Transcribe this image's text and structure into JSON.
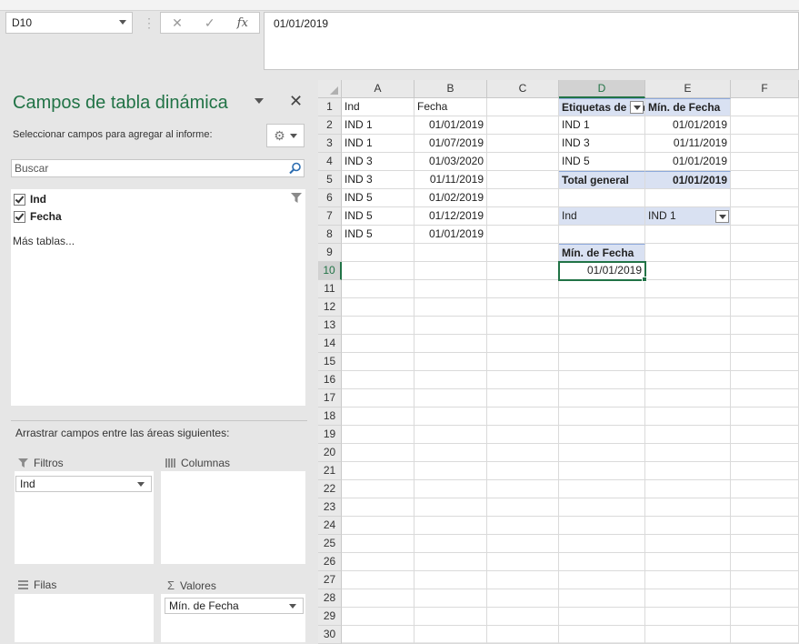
{
  "formula_bar": {
    "name_box": "D10",
    "cancel_icon": "✕",
    "enter_icon": "✓",
    "fx_label": "fx",
    "formula": "01/01/2019"
  },
  "pivot_pane": {
    "title": "Campos de tabla dinámica",
    "subtitle": "Seleccionar campos para agregar al informe:",
    "search_placeholder": "Buscar",
    "fields": [
      {
        "label": "Ind",
        "checked": true
      },
      {
        "label": "Fecha",
        "checked": true
      }
    ],
    "more_tables": "Más tablas...",
    "drag_label": "Arrastrar campos entre las áreas siguientes:",
    "areas": {
      "filters": {
        "label": "Filtros",
        "items": [
          "Ind"
        ]
      },
      "columns": {
        "label": "Columnas",
        "items": []
      },
      "rows": {
        "label": "Filas",
        "items": []
      },
      "values": {
        "label": "Valores",
        "items": [
          "Mín. de Fecha"
        ]
      }
    }
  },
  "sheet": {
    "columns": [
      "A",
      "B",
      "C",
      "D",
      "E",
      "F"
    ],
    "selected_column": "D",
    "rows": [
      "1",
      "2",
      "3",
      "4",
      "5",
      "6",
      "7",
      "8",
      "9",
      "10",
      "11",
      "12",
      "13",
      "14",
      "15",
      "16",
      "17",
      "18",
      "19",
      "20",
      "21",
      "22",
      "23",
      "24",
      "25",
      "26",
      "27",
      "28",
      "29",
      "30"
    ],
    "selected_row": "10",
    "source_table": {
      "headers": [
        "Ind",
        "Fecha"
      ],
      "rows": [
        [
          "IND 1",
          "01/01/2019"
        ],
        [
          "IND 1",
          "01/07/2019"
        ],
        [
          "IND 3",
          "01/03/2020"
        ],
        [
          "IND 3",
          "01/11/2019"
        ],
        [
          "IND 5",
          "01/02/2019"
        ],
        [
          "IND 5",
          "01/12/2019"
        ],
        [
          "IND 5",
          "01/01/2019"
        ]
      ]
    },
    "pivot1": {
      "header_labels": "Etiquetas de fila",
      "header_value": "Mín. de Fecha",
      "rows": [
        [
          "IND 1",
          "01/01/2019"
        ],
        [
          "IND 3",
          "01/11/2019"
        ],
        [
          "IND 5",
          "01/01/2019"
        ]
      ],
      "total_label": "Total general",
      "total_value": "01/01/2019"
    },
    "pivot2": {
      "filter_field": "Ind",
      "filter_value": "IND 1",
      "value_header": "Mín. de Fecha",
      "value": "01/01/2019"
    }
  },
  "colors": {
    "accent": "#217346",
    "pivot_fill": "#d9e1f2"
  }
}
